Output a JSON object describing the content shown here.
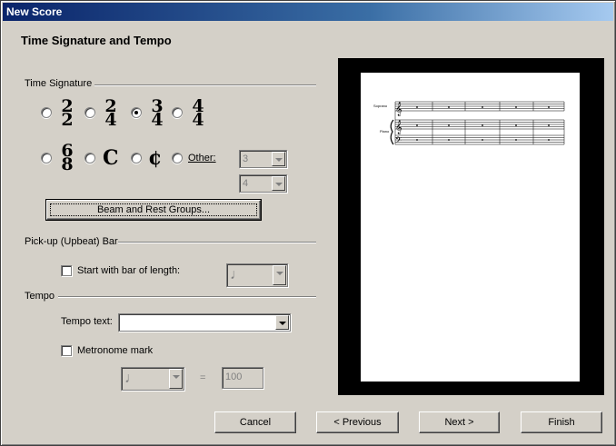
{
  "window": {
    "title": "New Score"
  },
  "page": {
    "heading": "Time Signature and Tempo"
  },
  "time_signature": {
    "group_label": "Time Signature",
    "options": [
      {
        "top": "2",
        "bottom": "2",
        "selected": false
      },
      {
        "top": "2",
        "bottom": "4",
        "selected": false
      },
      {
        "top": "3",
        "bottom": "4",
        "selected": true
      },
      {
        "top": "4",
        "bottom": "4",
        "selected": false
      },
      {
        "top": "6",
        "bottom": "8",
        "selected": false
      }
    ],
    "common_time_symbol": "C",
    "cut_time_symbol": "¢",
    "other_label": "Other:",
    "other_top_value": "3",
    "other_bottom_value": "4",
    "beam_button_label": "Beam and Rest Groups..."
  },
  "pickup": {
    "group_label": "Pick-up (Upbeat) Bar",
    "checkbox_label": "Start with bar of length:",
    "checked": false,
    "note_symbol": "♩"
  },
  "tempo": {
    "group_label": "Tempo",
    "tempo_text_label": "Tempo text:",
    "tempo_text_value": "",
    "metronome_label": "Metronome mark",
    "metronome_checked": false,
    "note_symbol": "♩",
    "equals": "=",
    "bpm_value": "100"
  },
  "preview": {
    "soprano_label": "Soprano",
    "piano_label": "Piano"
  },
  "footer": {
    "cancel_label": "Cancel",
    "previous_label": "< Previous",
    "next_label": "Next >",
    "finish_label": "Finish"
  }
}
